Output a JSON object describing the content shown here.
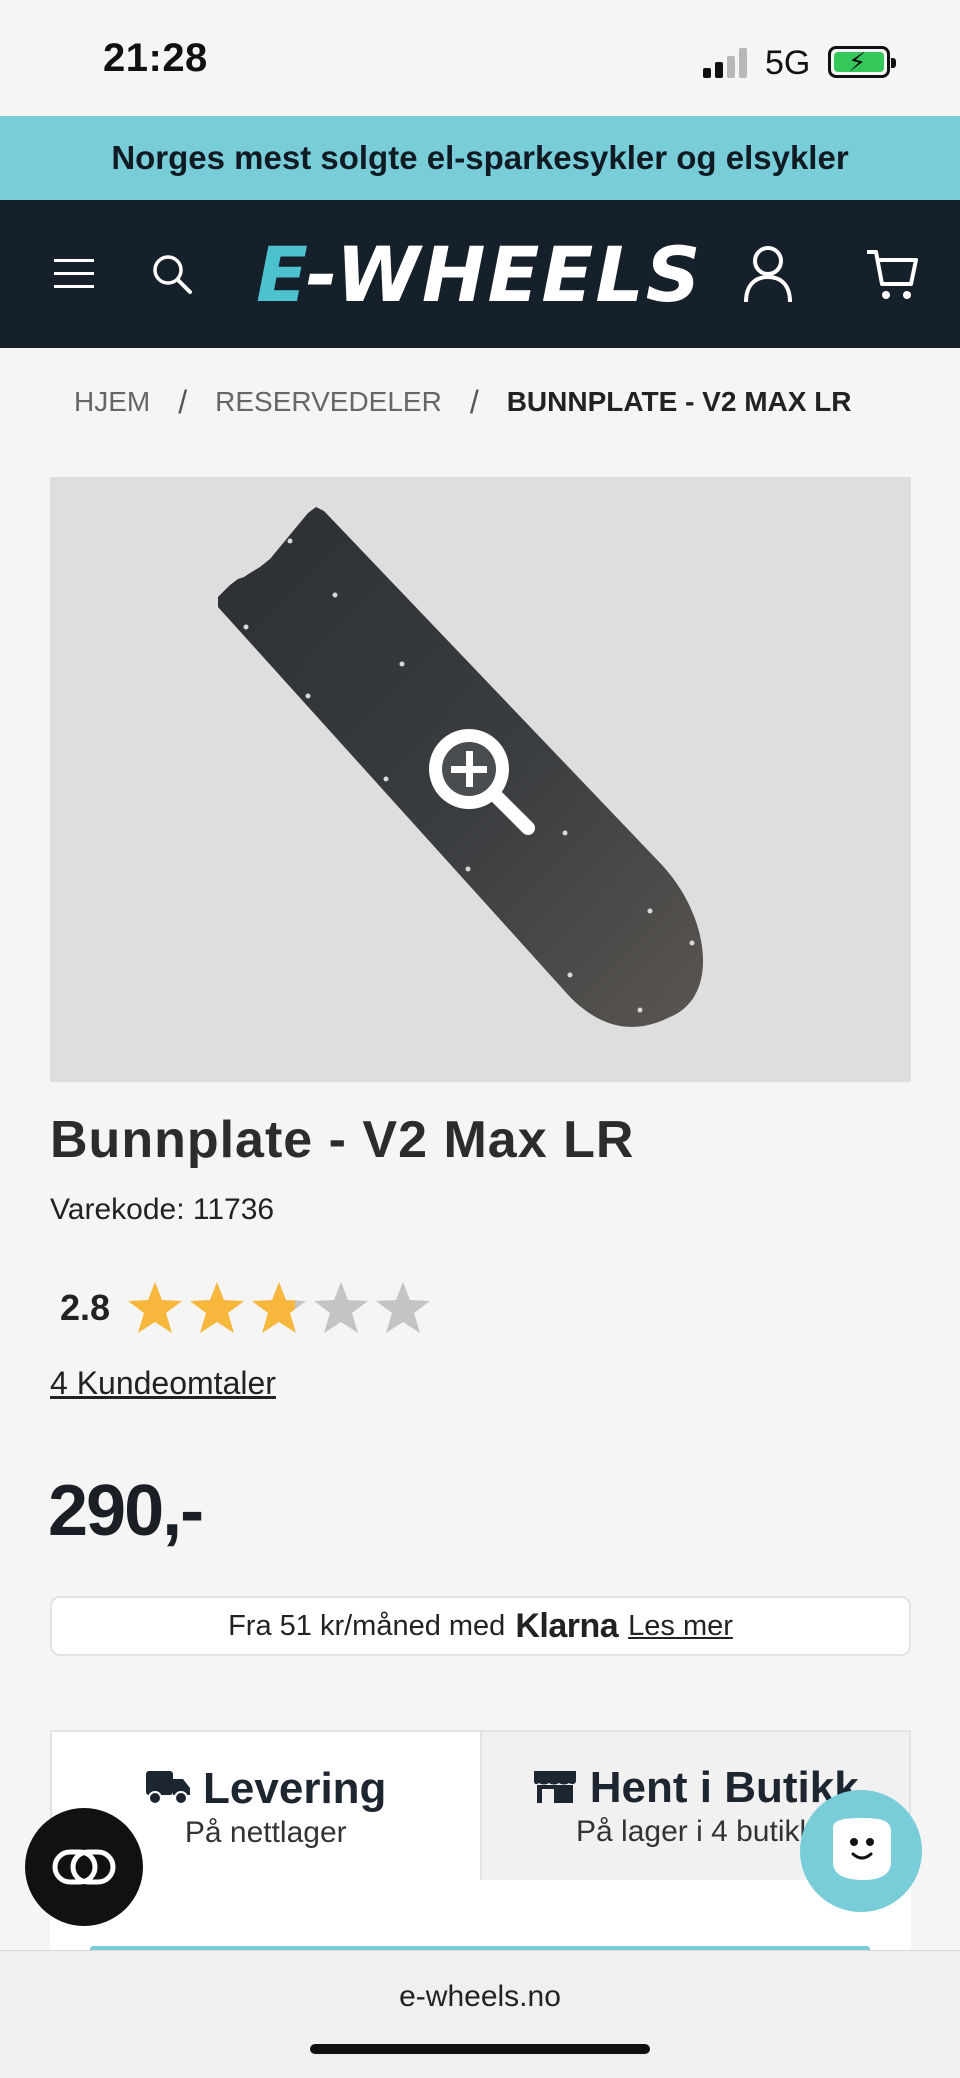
{
  "status_bar": {
    "time": "21:28",
    "network": "5G"
  },
  "promo": {
    "text": "Norges mest solgte el-sparkesykler og elsykler"
  },
  "header": {
    "logo_e": "E",
    "logo_rest": "-WHEELS"
  },
  "breadcrumb": {
    "items": [
      "HJEM",
      "RESERVEDELER",
      "BUNNPLATE - V2 MAX LR"
    ],
    "separator": "/"
  },
  "product": {
    "title": "Bunnplate - V2 Max LR",
    "sku_label": "Varekode: ",
    "sku_value": "11736",
    "rating": "2.8",
    "rating_value": 2.8,
    "rating_max": 5,
    "reviews": "4 Kundeomtaler",
    "price": "290,-"
  },
  "klarna": {
    "prefix": "Fra 51 kr/måned med",
    "logo": "Klarna",
    "link": "Les mer"
  },
  "delivery_tabs": [
    {
      "title": "Levering",
      "subtitle": "På nettlager",
      "icon": "truck-icon"
    },
    {
      "title": "Hent i Butikk",
      "subtitle": "På lager i 4 butikk",
      "icon": "store-icon"
    }
  ],
  "browser": {
    "url": "e-wheels.no"
  },
  "colors": {
    "accent": "#78cdd8",
    "header_bg": "#16202a",
    "logo_accent": "#4cc2cf",
    "star": "#f6b73c",
    "star_empty": "#c4c4c4"
  }
}
